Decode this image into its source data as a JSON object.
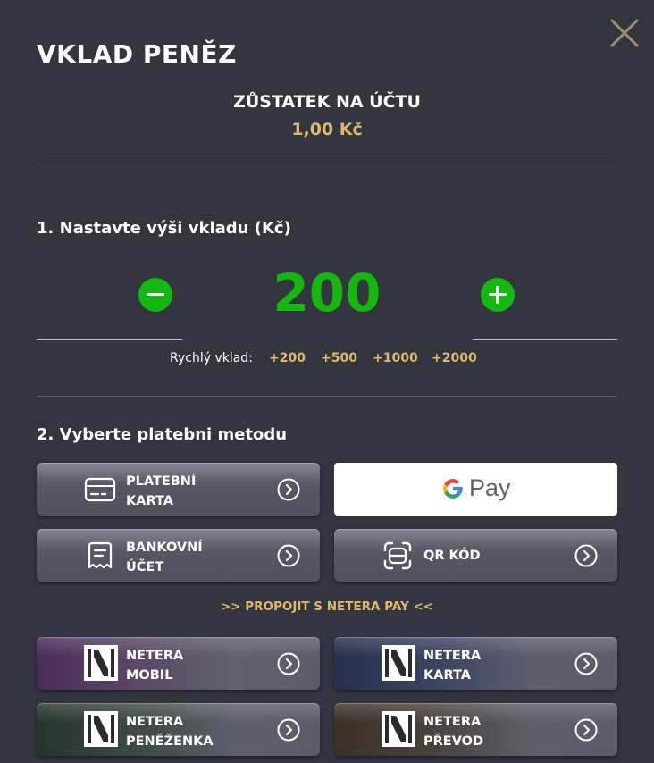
{
  "header": {
    "title": "VKLAD PENĚZ"
  },
  "balance": {
    "label": "ZŮSTATEK NA ÚČTU",
    "value": "1,00 Kč"
  },
  "step1": {
    "title": "1. Nastavte výši vkladu (Kč)",
    "amount": "200",
    "quick_label": "Rychlý vklad:",
    "quick_options": [
      "+200",
      "+500",
      "+1000",
      "+2000"
    ]
  },
  "step2": {
    "title": "2. Vyberte platebni metodu",
    "methods": {
      "card": {
        "line1": "PLATEBNÍ",
        "line2": "KARTA",
        "icon": "credit-card-icon"
      },
      "gpay": {
        "text": "Pay",
        "icon": "google-g-icon"
      },
      "bank": {
        "line1": "BANKOVNÍ",
        "line2": "ÚČET",
        "icon": "receipt-icon"
      },
      "qr": {
        "line1": "QR KÓD",
        "icon": "qr-scan-icon"
      }
    },
    "netera_link": ">> PROPOJIT S NETERA PAY <<",
    "netera": {
      "mobil": {
        "line1": "NETERA",
        "line2": "MOBIL"
      },
      "karta": {
        "line1": "NETERA",
        "line2": "KARTA"
      },
      "penezenka": {
        "line1": "NETERA",
        "line2": "PENĚŽENKA"
      },
      "prevod": {
        "line1": "NETERA",
        "line2": "PŘEVOD"
      }
    }
  },
  "colors": {
    "background": "#33363f",
    "accent_gold": "#e0b86b",
    "accent_green": "#14b90f",
    "close_icon": "#a0906a"
  }
}
